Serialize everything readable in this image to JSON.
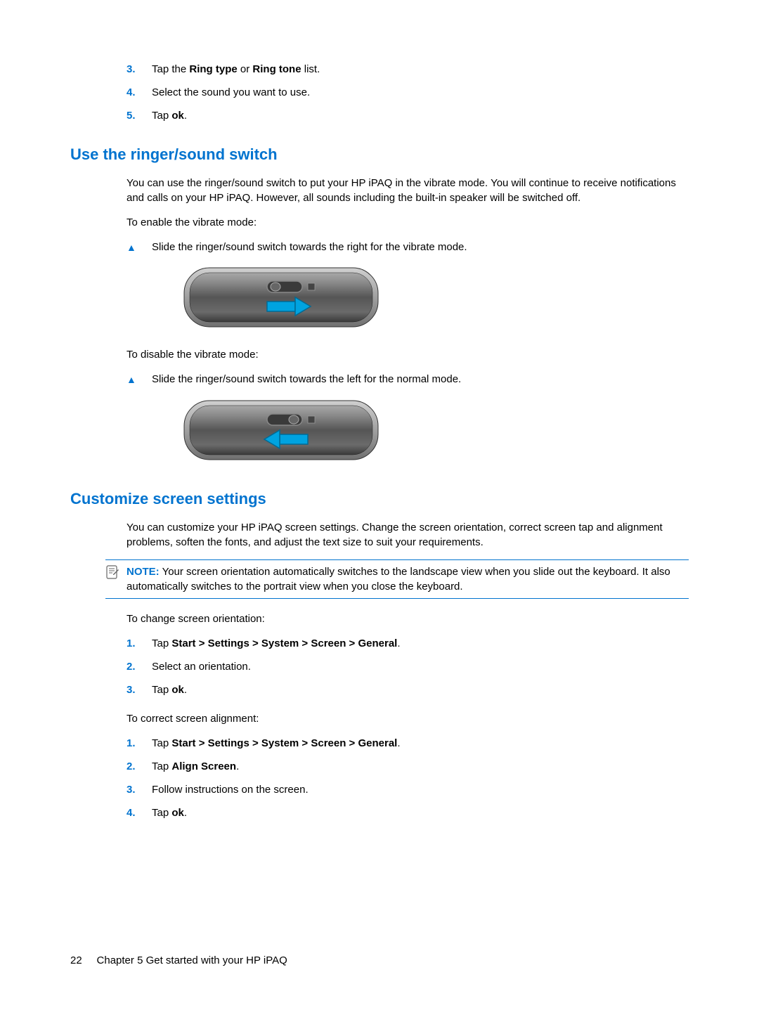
{
  "top_list": {
    "items": [
      {
        "num": "3.",
        "pre": "Tap the ",
        "bold1": "Ring type",
        "mid": " or ",
        "bold2": "Ring tone",
        "post": " list."
      },
      {
        "num": "4.",
        "text": "Select the sound you want to use."
      },
      {
        "num": "5.",
        "pre": "Tap ",
        "bold1": "ok",
        "post": "."
      }
    ]
  },
  "section1": {
    "heading": "Use the ringer/sound switch",
    "para1": "You can use the ringer/sound switch to put your HP iPAQ in the vibrate mode. You will continue to receive notifications and calls on your HP iPAQ. However, all sounds including the built-in speaker will be switched off.",
    "para2": "To enable the vibrate mode:",
    "bullet1": "Slide the ringer/sound switch towards the right for the vibrate mode.",
    "para3": "To disable the vibrate mode:",
    "bullet2": "Slide the ringer/sound switch towards the left for the normal mode."
  },
  "section2": {
    "heading": "Customize screen settings",
    "para1": "You can customize your HP iPAQ screen settings. Change the screen orientation, correct screen tap and alignment problems, soften the fonts, and adjust the text size to suit your requirements.",
    "note_label": "NOTE:",
    "note_text": "Your screen orientation automatically switches to the landscape view when you slide out the keyboard. It also automatically switches to the portrait view when you close the keyboard.",
    "para2": "To change screen orientation:",
    "list1": [
      {
        "num": "1.",
        "pre": "Tap ",
        "bold1": "Start > Settings > System > Screen > General",
        "post": "."
      },
      {
        "num": "2.",
        "text": "Select an orientation."
      },
      {
        "num": "3.",
        "pre": "Tap ",
        "bold1": "ok",
        "post": "."
      }
    ],
    "para3": "To correct screen alignment:",
    "list2": [
      {
        "num": "1.",
        "pre": "Tap ",
        "bold1": "Start > Settings > System > Screen > General",
        "post": "."
      },
      {
        "num": "2.",
        "pre": "Tap ",
        "bold1": "Align Screen",
        "post": "."
      },
      {
        "num": "3.",
        "text": "Follow instructions on the screen."
      },
      {
        "num": "4.",
        "pre": "Tap ",
        "bold1": "ok",
        "post": "."
      }
    ]
  },
  "footer": {
    "page": "22",
    "chapter": "Chapter 5   Get started with your HP iPAQ"
  }
}
